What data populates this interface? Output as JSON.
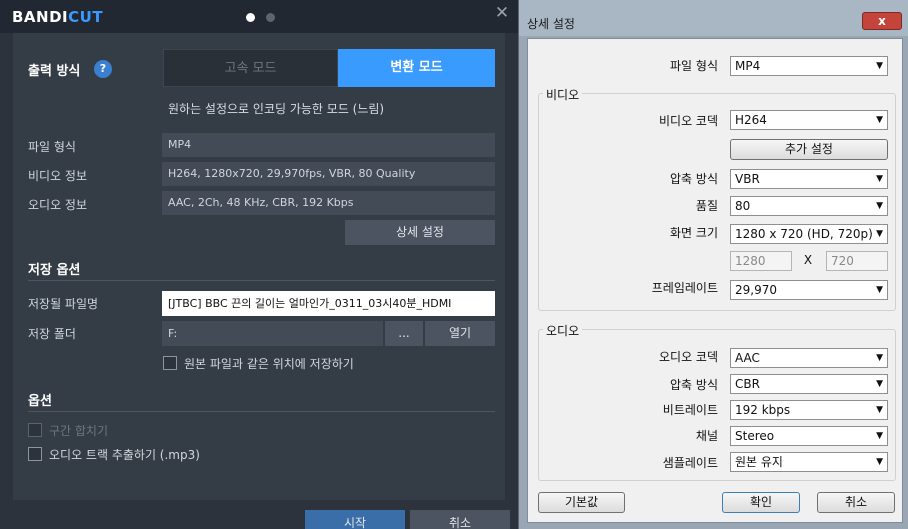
{
  "left": {
    "logo": {
      "brand": "BANDI",
      "accent": "CUT"
    },
    "output_mode": {
      "title": "출력 방식",
      "help": "?",
      "fast_mode": "고속 모드",
      "convert_mode": "변환 모드",
      "description": "원하는 설정으로 인코딩 가능한 모드 (느림)"
    },
    "info": {
      "file_format_label": "파일 형식",
      "file_format_value": "MP4",
      "video_info_label": "비디오 정보",
      "video_info_value": "H264, 1280x720, 29,970fps, VBR, 80 Quality",
      "audio_info_label": "오디오 정보",
      "audio_info_value": "AAC, 2Ch, 48 KHz, CBR, 192 Kbps",
      "detail_button": "상세 설정"
    },
    "save": {
      "title": "저장 옵션",
      "filename_label": "저장될 파일명",
      "filename_value": "[JTBC] BBC 끈의 길이는 얼마인가_0311_03시40분_HDMI",
      "folder_label": "저장 폴더",
      "folder_value": "F:",
      "browse_button": "...",
      "open_button": "열기",
      "same_location_label": "원본 파일과 같은 위치에 저장하기"
    },
    "options": {
      "title": "옵션",
      "merge_label": "구간 합치기",
      "extract_audio_label": "오디오 트랙 추출하기 (.mp3)"
    },
    "bottom": {
      "start": "시작",
      "cancel": "취소"
    }
  },
  "dialog": {
    "title": "상세 설정",
    "close": "x",
    "file_format_label": "파일 형식",
    "file_format_value": "MP4",
    "video_group": "비디오",
    "video_codec_label": "비디오 코덱",
    "video_codec_value": "H264",
    "extra_settings_button": "추가 설정",
    "compression_label": "압축 방식",
    "compression_value": "VBR",
    "quality_label": "품질",
    "quality_value": "80",
    "resolution_label": "화면 크기",
    "resolution_value": "1280 x 720 (HD, 720p)",
    "width_value": "1280",
    "x_sep": "X",
    "height_value": "720",
    "framerate_label": "프레임레이트",
    "framerate_value": "29,970",
    "audio_group": "오디오",
    "audio_codec_label": "오디오 코덱",
    "audio_codec_value": "AAC",
    "audio_compression_label": "압축 방식",
    "audio_compression_value": "CBR",
    "bitrate_label": "비트레이트",
    "bitrate_value": "192 kbps",
    "channel_label": "채널",
    "channel_value": "Stereo",
    "samplerate_label": "샘플레이트",
    "samplerate_value": "원본 유지",
    "default_button": "기본값",
    "ok_button": "확인",
    "cancel_button": "취소"
  },
  "colors": {
    "accent": "#3a9bff",
    "panel": "#343c46",
    "dialog_bg": "#f0f0f0"
  },
  "icons": {
    "help": "help-icon",
    "close": "close-icon",
    "dropdown": "chevron-down-icon"
  }
}
